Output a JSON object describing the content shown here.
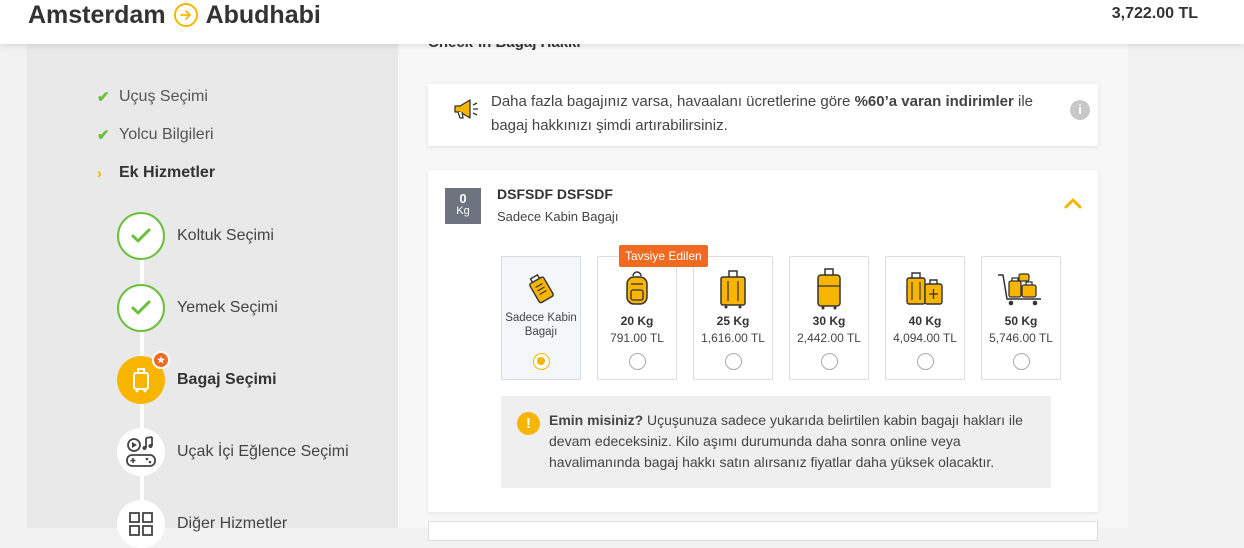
{
  "header": {
    "origin": "Amsterdam",
    "destination": "Abudhabi",
    "total_price": "3,722.00 TL"
  },
  "sidebar": {
    "steps": [
      {
        "label": "Uçuş Seçimi",
        "state": "done"
      },
      {
        "label": "Yolcu Bilgileri",
        "state": "done"
      },
      {
        "label": "Ek Hizmetler",
        "state": "active"
      }
    ],
    "substeps": [
      {
        "label": "Koltuk Seçimi",
        "state": "done",
        "icon": "check-icon"
      },
      {
        "label": "Yemek Seçimi",
        "state": "done",
        "icon": "check-icon"
      },
      {
        "label": "Bagaj Seçimi",
        "state": "current",
        "icon": "luggage-icon"
      },
      {
        "label": "Uçak İçi Eğlence Seçimi",
        "state": "todo",
        "icon": "entertainment-icon"
      },
      {
        "label": "Diğer Hizmetler",
        "state": "todo",
        "icon": "grid-icon"
      }
    ]
  },
  "main": {
    "section_title": "Check-in Bagaj Hakkı",
    "info": {
      "prefix": "Daha fazla bagajınız varsa, havaalanı ücretlerine göre ",
      "highlight": "%60’a varan indirimler",
      "suffix": " ile bagaj hakkınızı şimdi artırabilirsiniz."
    },
    "passenger": {
      "kg_value": "0",
      "kg_unit": "Kg",
      "name": "DSFSDF DSFSDF",
      "allowance": "Sadece Kabin Bagajı"
    },
    "recommended_label": "Tavsiye Edilen",
    "options": [
      {
        "label": "Sadece Kabin Bagajı",
        "selected": true,
        "icon": "cabin-bag-icon"
      },
      {
        "kg": "20 Kg",
        "price": "791.00 TL",
        "selected": false,
        "icon": "backpack-icon"
      },
      {
        "kg": "25 Kg",
        "price": "1,616.00 TL",
        "selected": false,
        "icon": "suitcase-icon"
      },
      {
        "kg": "30 Kg",
        "price": "2,442.00 TL",
        "selected": false,
        "icon": "suitcase-icon"
      },
      {
        "kg": "40 Kg",
        "price": "4,094.00 TL",
        "selected": false,
        "icon": "two-suitcases-icon"
      },
      {
        "kg": "50 Kg",
        "price": "5,746.00 TL",
        "selected": false,
        "icon": "luggage-cart-icon"
      }
    ],
    "warning": {
      "title": "Emin misiniz?",
      "text": " Uçuşunuza sadece yukarıda belirtilen kabin bagajı hakları ile devam edeceksiniz. Kilo aşımı durumunda daha sonra online veya havalimanında bagaj hakkı satın alırsanız fiyatlar daha yüksek olacaktır."
    }
  },
  "colors": {
    "accent": "#f7b500",
    "success": "#6cbf3a",
    "recommend": "#f06a1f"
  }
}
